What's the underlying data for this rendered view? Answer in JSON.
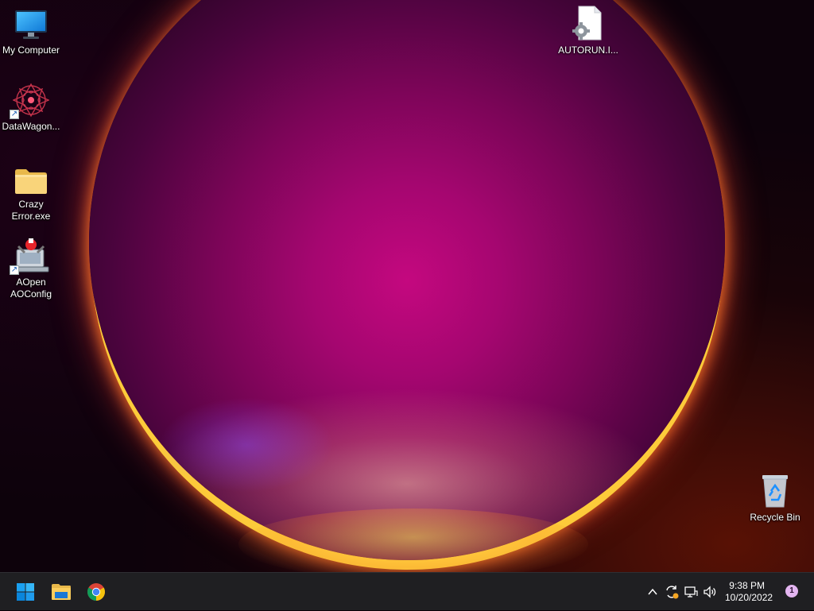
{
  "desktop": {
    "icons": [
      {
        "label": "My Computer",
        "icon": "monitor-icon",
        "shortcut": false
      },
      {
        "label": "DataWagon...",
        "icon": "mandala-icon",
        "shortcut": true
      },
      {
        "label": "Crazy\nError.exe",
        "icon": "folder-icon",
        "shortcut": false
      },
      {
        "label": "AOpen\nAOConfig",
        "icon": "computer-tools-icon",
        "shortcut": true
      },
      {
        "label": "AUTORUN.I...",
        "icon": "settings-file-icon",
        "shortcut": false
      },
      {
        "label": "Recycle Bin",
        "icon": "recycle-bin-icon",
        "shortcut": false
      }
    ]
  },
  "taskbar": {
    "pinned": [
      {
        "name": "Start",
        "icon": "windows-logo-icon"
      },
      {
        "name": "File Explorer",
        "icon": "folder-icon"
      },
      {
        "name": "Google Chrome",
        "icon": "chrome-icon"
      }
    ],
    "tray": {
      "icons": [
        "chevron-up-icon",
        "sync-icon",
        "network-icon",
        "volume-icon"
      ],
      "time": "9:38 PM",
      "date": "10/20/2022",
      "notification_count": "1"
    }
  },
  "colors": {
    "taskbar": "#1f1f22",
    "accent": "#0078d4",
    "notification_badge": "#e3b5f0"
  }
}
